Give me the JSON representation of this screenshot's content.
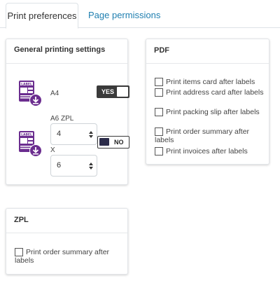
{
  "tabs": [
    {
      "label": "Print preferences",
      "active": true
    },
    {
      "label": "Page permissions",
      "active": false
    }
  ],
  "general": {
    "title": "General printing settings",
    "row1": {
      "format": "A4",
      "icon": "label-download-icon",
      "toggle_label": "YES",
      "toggle_on": true
    },
    "row2": {
      "format": "A6 ZPL",
      "icon": "label-download-icon",
      "toggle_label": "NO",
      "toggle_on": false,
      "width_value": "4",
      "separator": "X",
      "height_value": "6"
    }
  },
  "pdf": {
    "title": "PDF",
    "options": [
      {
        "label": "Print items card after labels",
        "checked": false
      },
      {
        "label": "Print address card after labels",
        "checked": false
      },
      {
        "label": "Print packing slip after labels",
        "checked": false
      },
      {
        "label": "Print order summary after labels",
        "checked": false
      },
      {
        "label": "Print invoices after labels",
        "checked": false
      }
    ]
  },
  "zpl": {
    "title": "ZPL",
    "options": [
      {
        "label": "Print order summary after labels",
        "checked": false
      }
    ]
  },
  "colors": {
    "accent_link": "#1f7fb0",
    "icon_purple": "#6b2d8f",
    "toggle_dark": "#3a3a3a"
  }
}
